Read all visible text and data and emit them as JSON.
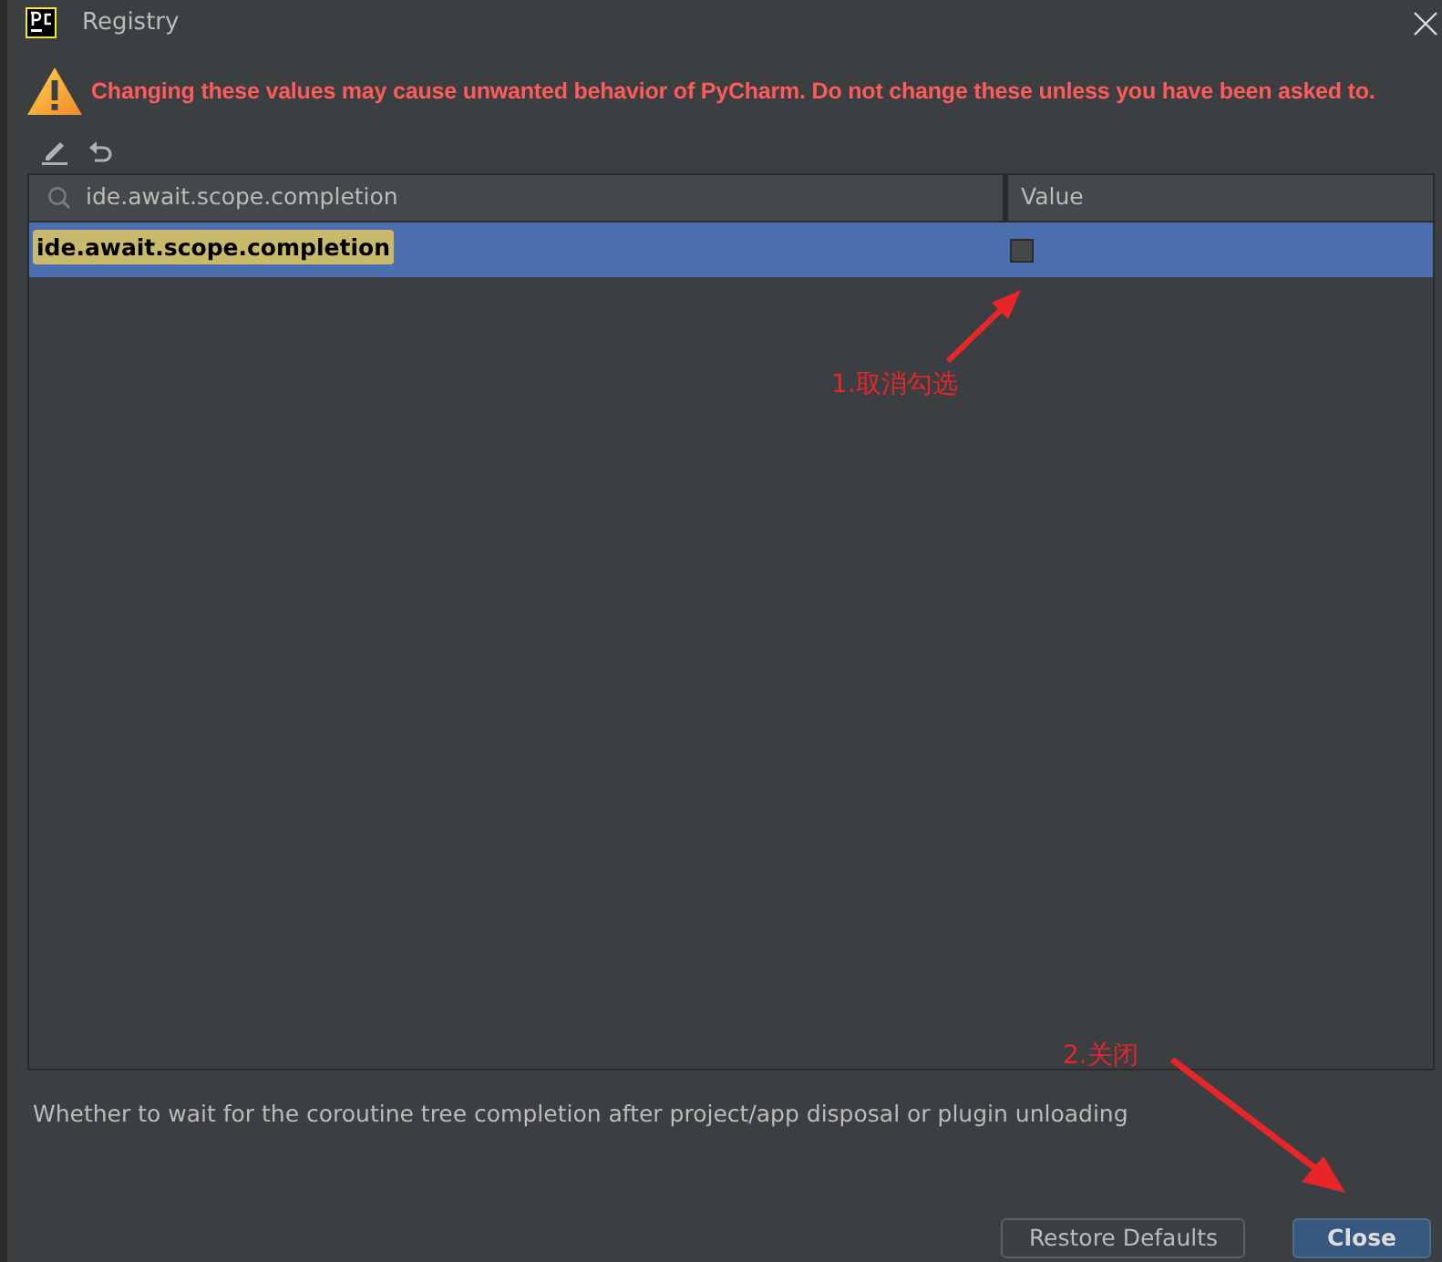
{
  "window": {
    "title": "Registry"
  },
  "warning": "Changing these values may cause unwanted behavior of PyCharm. Do not change these unless you have been asked to.",
  "search": {
    "value": "ide.await.scope.completion"
  },
  "table": {
    "columns": [
      "Value"
    ],
    "rows": [
      {
        "key": "ide.await.scope.completion",
        "checked": false,
        "selected": true
      }
    ]
  },
  "description": "Whether to wait for the coroutine tree completion after project/app disposal or plugin unloading",
  "buttons": [
    {
      "label": "Restore Defaults",
      "kind": "secondary"
    },
    {
      "label": "Close",
      "kind": "primary"
    }
  ],
  "annotations": [
    {
      "text": "1.取消勾选",
      "kind": "checkbox-note"
    },
    {
      "text": "2.关闭",
      "kind": "close-note"
    }
  ]
}
